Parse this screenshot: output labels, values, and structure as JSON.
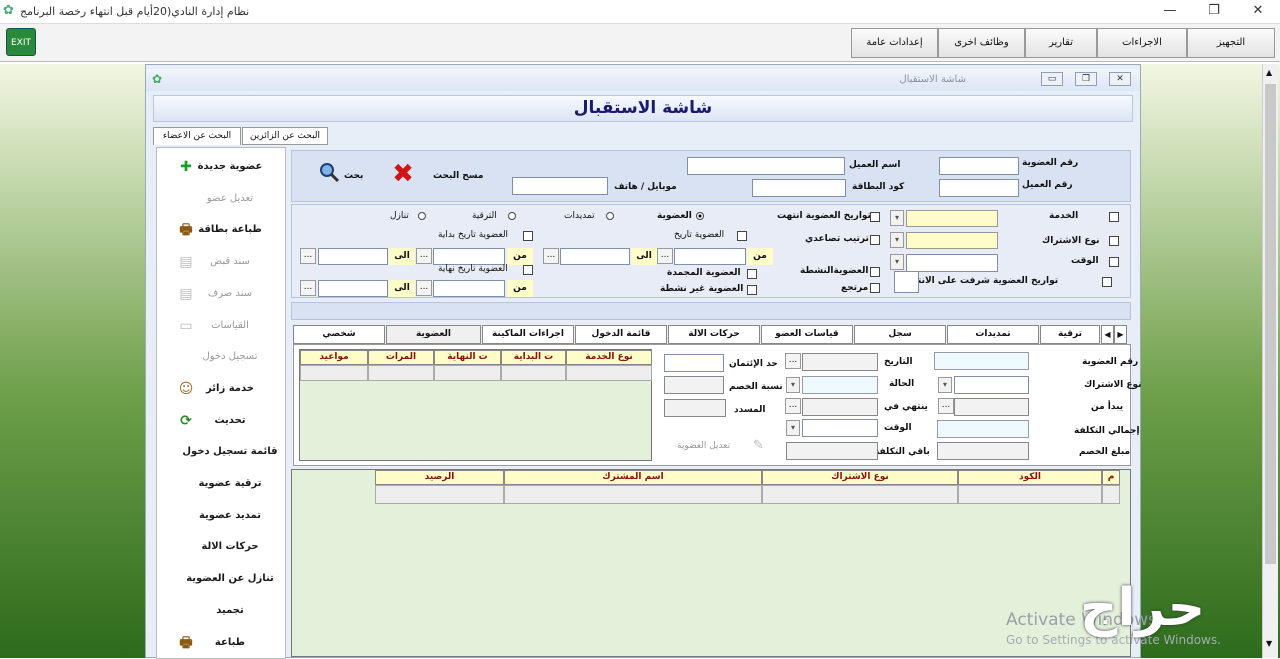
{
  "window": {
    "title": "نظام إدارة النادي(20أيام قبل انتهاء رخصة البرنامج"
  },
  "menu": [
    "التجهيز",
    "الاجراءات",
    "تقارير",
    "وظائف اخرى",
    "إعدادات عامة"
  ],
  "menu_icons": {
    "exit": "door-exit-icon"
  },
  "child": {
    "title": "شاشة الاستقبال",
    "heading": "شاشة الاستقبال"
  },
  "top_tabs": [
    "البحث عن الاعضاء",
    "البحث عن الزائرين"
  ],
  "left_panel": [
    {
      "label": "عضوية جديدة",
      "enabled": true,
      "icon": "plus-icon"
    },
    {
      "label": "تعديل عضو",
      "enabled": false,
      "icon": ""
    },
    {
      "label": "طباعة بطاقة",
      "enabled": true,
      "icon": "printer-icon"
    },
    {
      "label": "سند قبض",
      "enabled": false,
      "icon": "receipt-icon"
    },
    {
      "label": "سند صرف",
      "enabled": false,
      "icon": "receipt-icon"
    },
    {
      "label": "القياسات",
      "enabled": false,
      "icon": "ruler-icon"
    },
    {
      "label": "تسجيل دخول",
      "enabled": false,
      "icon": ""
    },
    {
      "label": "خدمة زائر",
      "enabled": true,
      "icon": "visitor-icon"
    },
    {
      "label": "تحديث",
      "enabled": true,
      "icon": "refresh-icon"
    },
    {
      "label": "قائمة تسجيل دخول",
      "enabled": true,
      "icon": ""
    },
    {
      "label": "ترقية عضوية",
      "enabled": true,
      "icon": ""
    },
    {
      "label": "تمديد عضوية",
      "enabled": true,
      "icon": ""
    },
    {
      "label": "حركات الالة",
      "enabled": true,
      "icon": ""
    },
    {
      "label": "تنازل عن العضوية",
      "enabled": true,
      "icon": ""
    },
    {
      "label": "تجميد",
      "enabled": true,
      "icon": ""
    },
    {
      "label": "طباعة",
      "enabled": true,
      "icon": "printer-icon"
    }
  ],
  "search": {
    "membership_no": "رقم العضوية",
    "client_no": "رقم العميل",
    "client_name": "اسم العميل",
    "card_code": "كود البطاقة",
    "mobile": "موبايل / هاتف",
    "clear": "مسح البحث",
    "search": "بحث"
  },
  "filters": {
    "service": "الخدمة",
    "sub_type": "نوع الاشتراك",
    "time": "الوقت",
    "near_expiry": "تواريخ العضوية شرفت على الانتهاء",
    "ended_dates": "تواريخ العضوية انتهت",
    "ascending": "ترتيب تصاعدي",
    "active": "العضويةالنشطة",
    "returned": "مرتجع",
    "membership": "العضوية",
    "extensions": "تمديدات",
    "upgrade": "الترقية",
    "waiver": "تنازل",
    "membership_date": "العضوية تاريخ",
    "frozen": "العضوية المجمدة",
    "inactive": "العضوية غير نشطة",
    "start_date": "العضوية تاريخ بداية",
    "end_date": "العضوية تاريخ نهاية",
    "from": "من",
    "to": "الى",
    "dots": "..."
  },
  "detail_tabs": [
    "شخصي",
    "العضوية",
    "اجراءات الماكينة",
    "قائمة الدخول",
    "حركات الالة",
    "قياسات العضو",
    "سجل",
    "تمديدات",
    "ترقية"
  ],
  "membership_form": {
    "membership_no": "رقم العضوية",
    "sub_type": "نوع الاشتراك",
    "starts_from": "يبدأ من",
    "total_cost": "إجمالي التكلفة",
    "discount_amount": "مبلغ الخصم",
    "date": "التاريخ",
    "status": "الحالة",
    "ends_in": "ينتهي في",
    "time": "الوقت",
    "remaining_cost": "باقي التكلفة",
    "credit_limit": "حد الإئتمان",
    "discount_pct": "نسبة الخصم",
    "paid": "المسدد",
    "edit_membership": "تعديل العضوية"
  },
  "service_grid": {
    "headers": [
      "نوع الخدمة",
      "ت البداية",
      "ت النهاية",
      "المرات",
      "مواعيد"
    ]
  },
  "bottom_grid": {
    "headers": [
      "م",
      "الكود",
      "نوع الاشتراك",
      "اسم المشترك",
      "الرصيد"
    ]
  },
  "watermark": {
    "line1": "Activate Windows",
    "line2": "Go to Settings to activate Windows."
  },
  "logo": "حراج",
  "colors": {
    "heading": "#1b1b6b",
    "grid_header": "#fefcc8",
    "grid_bg": "#e3f0da",
    "side_green": "#2d6b1c"
  }
}
